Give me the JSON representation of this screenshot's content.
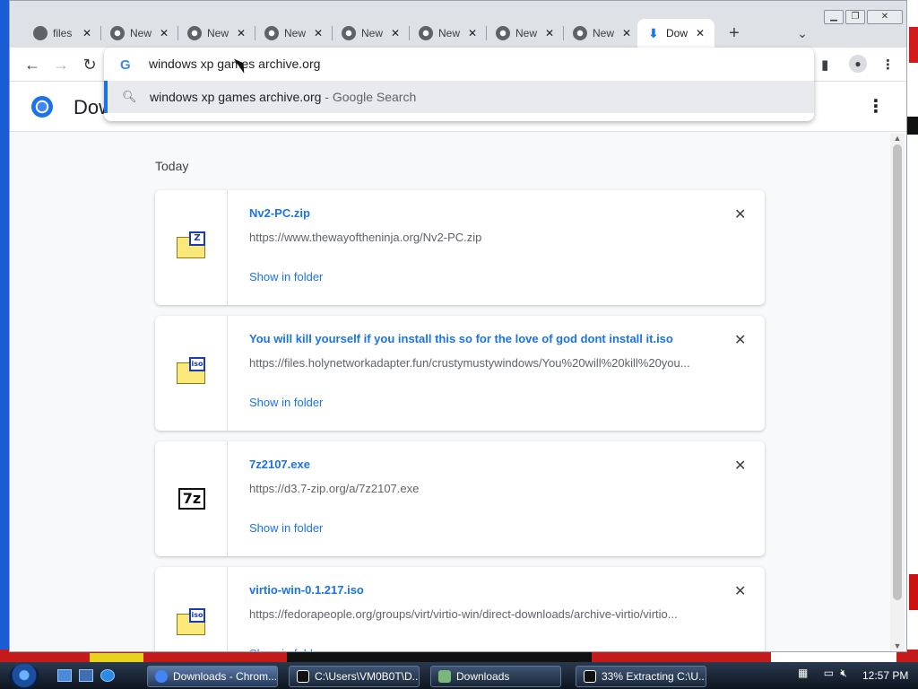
{
  "browser": {
    "tabs": [
      {
        "label": "files",
        "icon": "globe-icon"
      },
      {
        "label": "New",
        "icon": "chrome-icon"
      },
      {
        "label": "New",
        "icon": "chrome-icon"
      },
      {
        "label": "New",
        "icon": "chrome-icon"
      },
      {
        "label": "New",
        "icon": "chrome-icon"
      },
      {
        "label": "New",
        "icon": "chrome-icon"
      },
      {
        "label": "New",
        "icon": "chrome-icon"
      },
      {
        "label": "New",
        "icon": "chrome-icon"
      },
      {
        "label": "Dow",
        "icon": "download-icon",
        "active": true
      }
    ],
    "new_tab": "+",
    "omnibox": {
      "value": "windows xp games archive.org",
      "suggestion_query": "windows xp games archive.org",
      "suggestion_suffix": " - Google Search"
    }
  },
  "downloads": {
    "title": "Downloads",
    "section": "Today",
    "show_in_folder": "Show in folder",
    "items": [
      {
        "name": "Nv2-PC.zip",
        "url": "https://www.thewayoftheninja.org/Nv2-PC.zip",
        "icon": "zip",
        "icon_text": "Z"
      },
      {
        "name": "You will kill yourself if you install this so for the love of god dont install it.iso",
        "url": "https://files.holynetworkadapter.fun/crustymustywindows/You%20will%20kill%20you...",
        "icon": "iso",
        "icon_text": "iso"
      },
      {
        "name": "7z2107.exe",
        "url": "https://d3.7-zip.org/a/7z2107.exe",
        "icon": "7z",
        "icon_text": "7z"
      },
      {
        "name": "virtio-win-0.1.217.iso",
        "url": "https://fedorapeople.org/groups/virt/virtio-win/direct-downloads/archive-virtio/virtio...",
        "icon": "iso",
        "icon_text": "iso"
      }
    ]
  },
  "taskbar": {
    "buttons": [
      {
        "label": "Downloads - Chrom...",
        "active": true
      },
      {
        "label": "C:\\Users\\VM0B0T\\D..."
      },
      {
        "label": "Downloads"
      },
      {
        "label": "33% Extracting C:\\U..."
      }
    ],
    "clock": "12:57 PM"
  },
  "colors": {
    "accent": "#1a73e8",
    "desktop": "#1a5bd6"
  }
}
